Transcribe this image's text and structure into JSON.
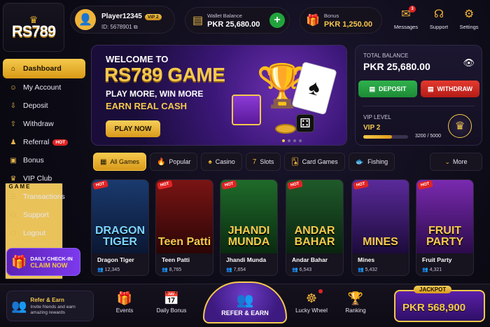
{
  "logo": {
    "brand": "RS789",
    "sub": "GAME"
  },
  "sidebar": {
    "items": [
      {
        "label": "Dashboard",
        "icon": "home-icon"
      },
      {
        "label": "My Account",
        "icon": "user-icon"
      },
      {
        "label": "Deposit",
        "icon": "deposit-icon"
      },
      {
        "label": "Withdraw",
        "icon": "withdraw-icon"
      },
      {
        "label": "Referral",
        "icon": "referral-icon",
        "badge": "HOT"
      },
      {
        "label": "Bonus",
        "icon": "gift-icon"
      },
      {
        "label": "VIP Club",
        "icon": "crown-icon"
      },
      {
        "label": "Transactions",
        "icon": "list-icon"
      },
      {
        "label": "Support",
        "icon": "headset-icon"
      },
      {
        "label": "Logout",
        "icon": "logout-icon"
      }
    ],
    "checkin": {
      "title": "DAILY CHECK-IN",
      "cta": "CLAIM NOW"
    }
  },
  "header": {
    "username": "Player12345",
    "vip_badge": "VIP 2",
    "user_id": "ID: 5678901",
    "wallet_label": "Wallet Balance",
    "wallet_amount": "PKR 25,680.00",
    "bonus_label": "Bonus",
    "bonus_amount": "PKR 1,250.00",
    "messages_label": "Messages",
    "messages_count": "3",
    "support_label": "Support",
    "settings_label": "Settings"
  },
  "banner": {
    "welcome": "WELCOME TO",
    "title": "RS789 GAME",
    "line1": "PLAY MORE, WIN MORE",
    "line2": "EARN REAL CASH",
    "cta": "PLAY NOW"
  },
  "balance": {
    "label": "TOTAL BALANCE",
    "amount": "PKR 25,680.00",
    "deposit": "DEPOSIT",
    "withdraw": "WITHDRAW",
    "vip_label": "VIP LEVEL",
    "vip_value": "VIP 2",
    "vip_progress_text": "3200 / 5000",
    "vip_progress": 0.64
  },
  "categories": [
    {
      "label": "All Games",
      "icon": "grid-icon"
    },
    {
      "label": "Popular",
      "icon": "flame-icon"
    },
    {
      "label": "Casino",
      "icon": "spade-icon"
    },
    {
      "label": "Slots",
      "icon": "slots-icon"
    },
    {
      "label": "Card Games",
      "icon": "cards-icon"
    },
    {
      "label": "Fishing",
      "icon": "fish-icon"
    }
  ],
  "more_label": "More",
  "games": [
    {
      "art": "DRAGON TIGER",
      "name": "Dragon Tiger",
      "players": "12,345",
      "bg1": "#1a3a6e",
      "bg2": "#0b1733",
      "color": "#7dd3fc"
    },
    {
      "art": "Teen Patti",
      "name": "Teen Patti",
      "players": "8,765",
      "bg1": "#7a1414",
      "bg2": "#2a0606",
      "color": "#f5c94c"
    },
    {
      "art": "JHANDI MUNDA",
      "name": "Jhandi Munda",
      "players": "7,654",
      "bg1": "#1f6b2a",
      "bg2": "#0a2a10",
      "color": "#f5c94c"
    },
    {
      "art": "ANDAR BAHAR",
      "name": "Andar Bahar",
      "players": "6,543",
      "bg1": "#1f5a2a",
      "bg2": "#0a230f",
      "color": "#f5c94c"
    },
    {
      "art": "MINES",
      "name": "Mines",
      "players": "5,432",
      "bg1": "#5a2a9a",
      "bg2": "#1c0b3a",
      "color": "#f5c94c"
    },
    {
      "art": "FRUIT PARTY",
      "name": "Fruit Party",
      "players": "4,321",
      "bg1": "#7a2ab0",
      "bg2": "#2a0b4a",
      "color": "#f5c94c"
    }
  ],
  "hot_label": "HOT",
  "bottom": {
    "refer_title": "Refer & Earn",
    "refer_desc": "Invite friends and earn amazing rewards",
    "events": "Events",
    "daily_bonus": "Daily Bonus",
    "refer_button": "REFER & EARN",
    "lucky_wheel": "Lucky Wheel",
    "ranking": "Ranking",
    "jackpot_label": "JACKPOT",
    "jackpot_amount": "PKR 568,900"
  }
}
